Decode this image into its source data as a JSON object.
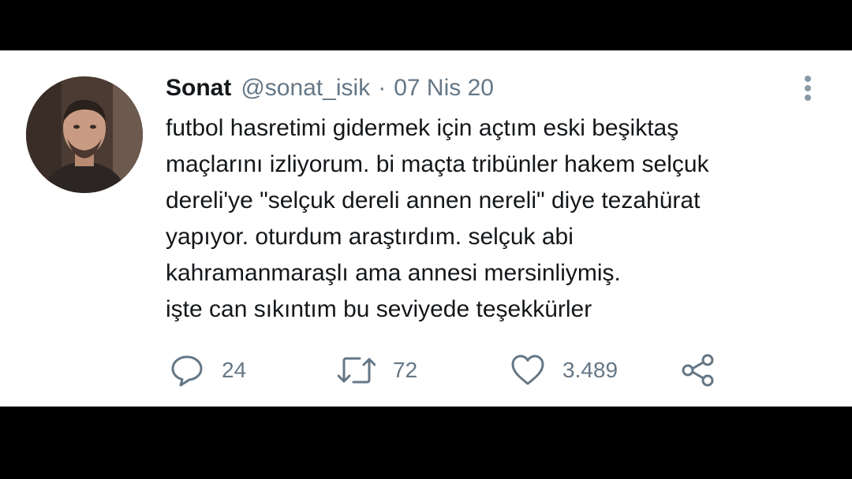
{
  "tweet": {
    "display_name": "Sonat",
    "handle": "@sonat_isik",
    "separator": "·",
    "date": "07 Nis 20",
    "lines": [
      "futbol hasretimi gidermek için açtım eski beşiktaş",
      "maçlarını izliyorum. bi maçta tribünler hakem selçuk",
      "dereli'ye \"selçuk dereli annen nereli\" diye tezahürat",
      "yapıyor. oturdum araştırdım. selçuk abi",
      "kahramanmaraşlı ama annesi mersinliymiş.",
      "işte can sıkıntım bu seviyede teşekkürler"
    ]
  },
  "actions": {
    "reply": {
      "icon": "reply-icon",
      "count": "24"
    },
    "retweet": {
      "icon": "retweet-icon",
      "count": "72"
    },
    "like": {
      "icon": "heart-icon",
      "count": "3.489"
    },
    "share": {
      "icon": "share-icon"
    }
  },
  "colors": {
    "text_primary": "#14171a",
    "text_secondary": "#657786",
    "background": "#ffffff",
    "letterbox": "#000000"
  }
}
